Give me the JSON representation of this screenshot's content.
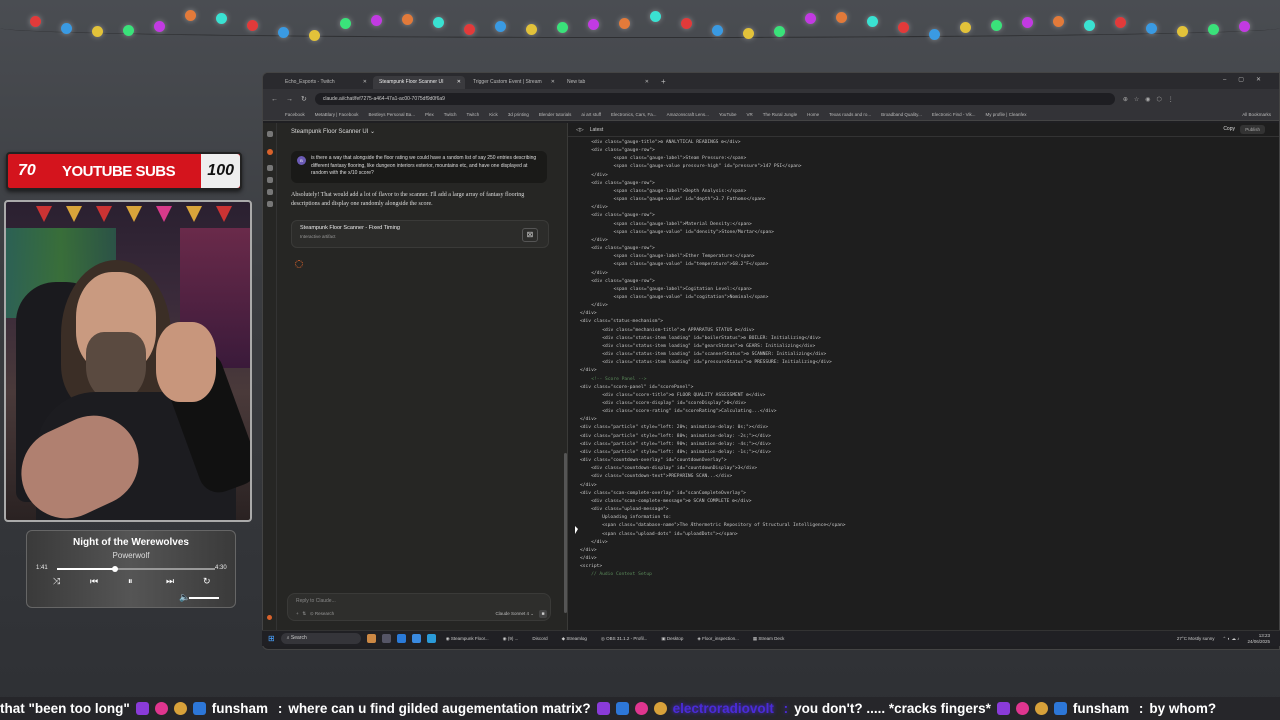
{
  "overlay": {
    "subs_current": "70",
    "subs_title": "YOUTUBE SUBS",
    "subs_goal": "100"
  },
  "music": {
    "song": "Night of the Werewolves",
    "artist": "Powerwolf",
    "elapsed": "1:41",
    "duration": "4:30",
    "progress": 0.37
  },
  "browser": {
    "tabs": [
      {
        "label": "Echo_Esports - Twitch",
        "active": false
      },
      {
        "label": "Steampunk Floor Scanner UI",
        "active": true
      },
      {
        "label": "Trigger Custom Event | Stream",
        "active": false
      },
      {
        "label": "New tab",
        "active": false
      }
    ],
    "url": "claude.ai/chat/fef7275-a464-47a1-ac00-7075df9d0f6a9",
    "bookmarks": [
      "Facebook",
      "MetaBlary | Facebook",
      "Bestleys Personal Ba...",
      "Plex",
      "Twitch",
      "Twitch",
      "Kick",
      "3d printing",
      "Blender tutorials",
      "ai art stuff",
      "Electronics, Cars, Fa...",
      "Amazonscraft Lens...",
      "YouTube",
      "VR",
      "The Rural Jungle",
      "Home",
      "Texas roads and ro...",
      "Broadband Quality...",
      "Electronic Find - Vik...",
      "My profile | Cleanfex"
    ],
    "all_bookmarks": "All Bookmarks"
  },
  "claude": {
    "chat_title": "Steampunk Floor Scanner UI",
    "user_avatar": "B",
    "user_message": "is there a way that alongside the floor rating we could have a random list of say 250 entries describing different fantasy flooring, like dungeon interiors exterior, mountains etc, and have one displayed at random with the x/10 score?",
    "assistant_reply": "Absolutely! That would add a lot of flavor to the scanner. I'll add a large array of fantasy flooring descriptions and display one randomly alongside the score.",
    "artifact_title": "Steampunk Floor Scanner - Fixed Timing",
    "artifact_sub": "Interactive artifact",
    "composer_placeholder": "Reply to Claude...",
    "composer_tool": "Research",
    "model": "Claude Sonnet 4",
    "code_version": "Latest",
    "copy_label": "Copy",
    "publish_label": "Publish"
  },
  "code_lines": [
    "<div class=\"gauge-title\">⚙ ANALYTICAL READINGS ⚙</div>",
    "<div class=\"gauge-row\">",
    "    <span class=\"gauge-label\">Steam Pressure:</span>",
    "    <span class=\"gauge-value pressure-high\" id=\"pressure\">147 PSI</span>",
    "</div>",
    "<div class=\"gauge-row\">",
    "    <span class=\"gauge-label\">Depth Analysis:</span>",
    "    <span class=\"gauge-value\" id=\"depth\">3.7 Fathoms</span>",
    "</div>",
    "<div class=\"gauge-row\">",
    "    <span class=\"gauge-label\">Material Density:</span>",
    "    <span class=\"gauge-value\" id=\"density\">Stone/Mortar</span>",
    "</div>",
    "<div class=\"gauge-row\">",
    "    <span class=\"gauge-label\">Ether Temperature:</span>",
    "    <span class=\"gauge-value\" id=\"temperature\">68.2°F</span>",
    "</div>",
    "<div class=\"gauge-row\">",
    "    <span class=\"gauge-label\">Cogitation Level:</span>",
    "    <span class=\"gauge-value\" id=\"cogitation\">Nominal</span>",
    "</div>",
    "</div>",
    "",
    "<div class=\"status-mechanism\">",
    "    <div class=\"mechanism-title\">⚙ APPARATUS STATUS ⚙</div>",
    "    <div class=\"status-item loading\" id=\"boilerStatus\">⚙ BOILER: Initializing</div>",
    "    <div class=\"status-item loading\" id=\"gearsStatus\">⚙ GEARS: Initializing</div>",
    "    <div class=\"status-item loading\" id=\"scannerStatus\">⚙ SCANNER: Initializing</div>",
    "    <div class=\"status-item loading\" id=\"pressureStatus\">⚙ PRESSURE: Initializing</div>",
    "</div>",
    "",
    "<!-- Score Panel -->",
    "<div class=\"score-panel\" id=\"scorePanel\">",
    "    <div class=\"score-title\">⚙ FLOOR QUALITY ASSESSMENT ⚙</div>",
    "    <div class=\"score-display\" id=\"scoreDisplay\">0</div>",
    "    <div class=\"score-rating\" id=\"scoreRating\">Calculating...</div>",
    "</div>",
    "",
    "<div class=\"particle\" style=\"left: 20%; animation-delay: 0s;\"></div>",
    "<div class=\"particle\" style=\"left: 80%; animation-delay: -2s;\"></div>",
    "<div class=\"particle\" style=\"left: 90%; animation-delay: -4s;\"></div>",
    "<div class=\"particle\" style=\"left: 40%; animation-delay: -1s;\"></div>",
    "",
    "<div class=\"countdown-overlay\" id=\"countdownOverlay\">",
    "    <div class=\"countdown-display\" id=\"countdownDisplay\">3</div>",
    "    <div class=\"countdown-text\">PREPARING SCAN...</div>",
    "</div>",
    "",
    "<div class=\"scan-complete-overlay\" id=\"scanCompleteOverlay\">",
    "    <div class=\"scan-complete-message\">⚙ SCAN COMPLETE ⚙</div>",
    "    <div class=\"upload-message\">",
    "        Uploading information to:",
    "        <span class=\"database-name\">The Æthermetric Repository of Structural Intelligence</span>",
    "        <span class=\"upload-dots\" id=\"uploadDots\"></span>",
    "    </div>",
    "</div>",
    "</div>",
    "",
    "<script>",
    "    // Audio Context Setup"
  ],
  "taskbar": {
    "search": "Search",
    "apps": [
      "Steampunk Floor...",
      "(9) ...",
      "Discord",
      "Streamlog",
      "OBS 31.1.2 - Profil...",
      "Desktop",
      "Floor_inspection...",
      "Stream Deck"
    ],
    "weather": "27°C Mostly sunny",
    "time": "13:23",
    "date": "24/06/2025"
  },
  "ticker": {
    "seg1": "that \"been too long\"",
    "user1": "funsham",
    "msg1": "where can u find gilded augementation matrix?",
    "user2": "electroradiovolt",
    "msg2": "you don't? ..... *cracks fingers*",
    "user3": "funsham",
    "msg3": "by whom?"
  }
}
